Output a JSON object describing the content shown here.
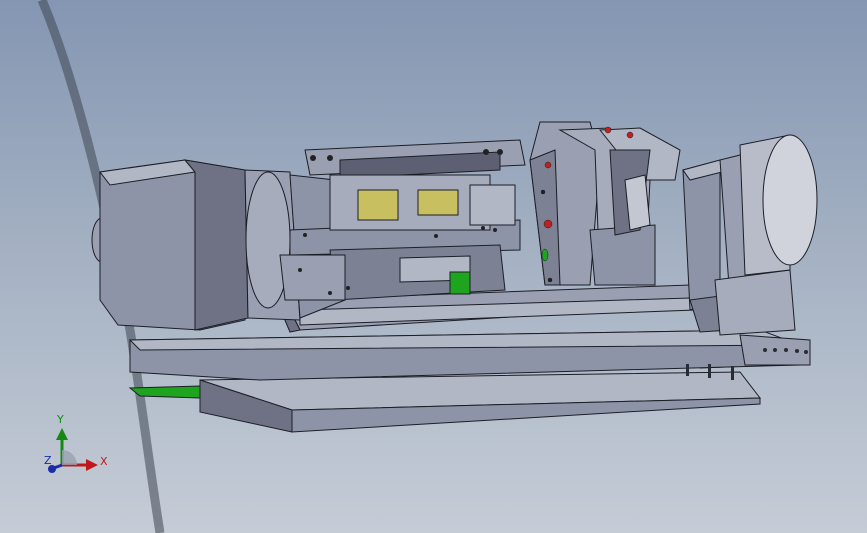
{
  "triad": {
    "x_label": "X",
    "y_label": "Y",
    "z_label": "Z"
  },
  "colors": {
    "background_top": "#8496b2",
    "background_bottom": "#c5ccd6",
    "part_gray": "#8e94a8",
    "part_light": "#b2b7c6",
    "part_dark": "#5c6072",
    "edge": "#1c1e26",
    "accent_green": "#1fa41f",
    "accent_yellow": "#c8c060",
    "accent_red": "#c02020",
    "axis_x": "#c01818",
    "axis_y": "#148a14",
    "axis_z": "#1a2ca8"
  }
}
